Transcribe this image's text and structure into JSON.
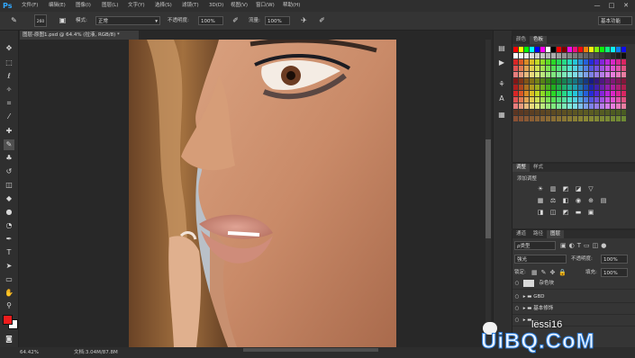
{
  "app": {
    "logo": "Ps"
  },
  "menu": {
    "items": [
      "文件(F)",
      "编辑(E)",
      "图像(I)",
      "图层(L)",
      "文字(Y)",
      "选择(S)",
      "滤镜(T)",
      "3D(D)",
      "视图(V)",
      "窗口(W)",
      "帮助(H)"
    ]
  },
  "window_controls": {
    "minimize": "—",
    "maximize": "□",
    "close": "✕"
  },
  "options": {
    "brush_size": "260",
    "mode_label": "模式:",
    "mode_value": "正常",
    "opacity_label": "不透明度:",
    "opacity_value": "100%",
    "flow_label": "流量:",
    "flow_value": "100%",
    "workspace": "基本功能"
  },
  "document": {
    "tab_title": "图层-原图1.psd @ 64.4% (拉液, RGB/8) *",
    "close": "×"
  },
  "status": {
    "zoom": "64.42%",
    "doc_info": "文档:3.04M/87.8M"
  },
  "swatches_panel": {
    "tabs": [
      "颜色",
      "色板"
    ]
  },
  "adjustments_panel": {
    "tabs": [
      "调整",
      "样式"
    ],
    "add_label": "添加调整"
  },
  "layers_panel": {
    "tabs": [
      "通道",
      "路径",
      "图层"
    ],
    "filter_kind": "ρ类型",
    "blend_mode": "强光",
    "opacity_label": "不透明度:",
    "opacity_value": "100%",
    "lock_label": "锁定:",
    "fill_label": "填充:",
    "fill_value": "100%",
    "layers": [
      {
        "name": "杂色块",
        "type": "layer"
      },
      {
        "name": "GBD",
        "type": "group"
      },
      {
        "name": "基本修饰",
        "type": "group"
      },
      {
        "name": "...",
        "type": "group"
      }
    ]
  },
  "watermark": {
    "brand": "UiBQ.CoM",
    "account": "lessi16"
  },
  "colors": {
    "foreground": "#ee1c1c",
    "background": "#ffffff",
    "accent": "#31a8ff"
  }
}
